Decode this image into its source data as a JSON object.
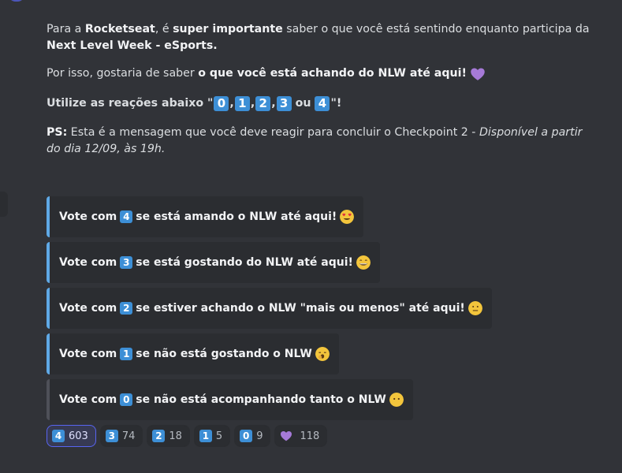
{
  "message": {
    "p1": {
      "t1": "Para a ",
      "b1": "Rocketseat",
      "t2": ", é ",
      "b2": "super importante",
      "t3": " saber o que você está sentindo enquanto participa da ",
      "b3": "Next Level Week - eSports."
    },
    "p2": {
      "t1": "Por isso, gostaria de saber ",
      "b1": "o que você está achando do NLW até aqui!"
    },
    "p3": {
      "t1": "Utilize as reações abaixo \"",
      "k0": "0",
      "k1": "1",
      "k2": "2",
      "k3": "3",
      "k4": "4",
      "comma": ",",
      "ou": "ou",
      "end": "\"!"
    },
    "p4": {
      "b1": "PS:",
      "t1": " Esta é a mensagem que você deve reagir para concluir o Checkpoint 2 - ",
      "i1": "Disponível a partir do dia 12/09, às 19h."
    }
  },
  "embeds": [
    {
      "pre": "Vote com",
      "key": "4",
      "post": "se está amando o NLW até aqui!",
      "emoji": "heart-eyes-emoji"
    },
    {
      "pre": "Vote com",
      "key": "3",
      "post": "se está gostando do NLW até aqui!",
      "emoji": "grin-emoji"
    },
    {
      "pre": "Vote com",
      "key": "2",
      "post": "se estiver achando o NLW \"mais ou menos\" até aqui!",
      "emoji": "neutral-emoji"
    },
    {
      "pre": "Vote com",
      "key": "1",
      "post": "se não está gostando o NLW",
      "emoji": "yawn-emoji"
    },
    {
      "pre": "Vote com",
      "key": "0",
      "post": "se não está acompanhando tanto o NLW",
      "emoji": "no-mouth-emoji"
    }
  ],
  "reactions": [
    {
      "key": "4",
      "count": "603",
      "active": true
    },
    {
      "key": "3",
      "count": "74"
    },
    {
      "key": "2",
      "count": "18"
    },
    {
      "key": "1",
      "count": "5"
    },
    {
      "key": "0",
      "count": "9"
    },
    {
      "key": "purple-heart",
      "count": "118"
    }
  ],
  "colors": {
    "background": "#313338",
    "embed_bg": "#2b2d31",
    "embed_border_blue": "#5fa9e6",
    "embed_border_gray": "#4e5058",
    "keycap": "#3d8fd6",
    "heart": "#a67ad8",
    "reaction_active_border": "#5865f2"
  }
}
